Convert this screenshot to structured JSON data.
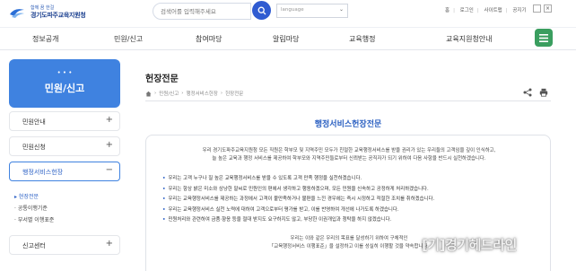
{
  "header": {
    "logo_sub": "함께 꿈 한걸",
    "logo_name": "경기도파주교육지원청",
    "search_placeholder": "검색어를 입력해주세요",
    "language_label": "language",
    "utils": [
      "홈",
      "로그인",
      "사이트맵",
      "공지기"
    ]
  },
  "gnb": {
    "items": [
      "정보공개",
      "민원/신고",
      "참여마당",
      "알림마당",
      "교육행정",
      "교육지원청안내"
    ]
  },
  "lnb": {
    "title": "민원/신고",
    "items": [
      {
        "label": "민원안내",
        "sign": "+"
      },
      {
        "label": "민원신청",
        "sign": "+"
      },
      {
        "label": "행정서비스헌장",
        "sign": "−"
      },
      {
        "label": "신고센터",
        "sign": "+"
      }
    ],
    "sub_items": [
      "현장전문",
      "공통이행기준",
      "부서별 이행표준"
    ]
  },
  "content": {
    "page_title": "헌장전문",
    "breadcrumb": [
      "민원/신고",
      "행정서비스헌장",
      "헌장전문"
    ],
    "charter_title": "행정서비스헌장전문",
    "intro_line1": "우리 경기도파주교육지원청 모든 직원은 학부모 및 지역주민 모두가 친절한 교육행정서비스를 받을 권리가 있는 우리들의 고객임을 깊이 인식하고,",
    "intro_line2": "늘 높은 교육과 행정 서비스를 제공하여 학부모와 지역주민들로부터 신뢰받는 공직자가 되기 위하여 다음 사항을 반드시 실천하겠습니다.",
    "items": [
      "우리는 고객 누구나 질 높은 교육행정서비스를 받을 수 있도록 고객 만족 행정을 실천하겠습니다.",
      "우리는 항상 밝은 미소와 상냥한 말씨로 민원인의 편에서 생각하고 행동하겠으며, 모든 민원을 신속하고 공정하게 처리하겠습니다.",
      "우리는 교육행정서비스를 제공하는 과정에서 고객이 불만족하거나 불편을 느낀 경우에는 즉시 시정하고 적절한 조치를 취하겠습니다.",
      "우리는 교육행정서비스 실천 노력에 대하여 고객으로부터 평가를 받고, 이를 반영하여 개선에 나가도록 하겠습니다.",
      "민원처리와 관련하여 금품·향응 등을 절대 받지도 요구하지도 않고, 부당한 이권개입과 청탁을 하지 않겠습니다."
    ],
    "closing_line1": "우리는 이와 같은 우리의 목표를 달성하기 위하여 구체적인",
    "closing_line2": "「교육행정서비스 이행표준」을 설정하고 이를 성실히 이행할 것을 약속합니다."
  },
  "watermark": "[기]경기헤드라인",
  "colors": {
    "primary": "#3f82e0",
    "search_button": "#2f5bd1",
    "menu_button": "#3a9e5f",
    "accent_text": "#2d62c6"
  }
}
